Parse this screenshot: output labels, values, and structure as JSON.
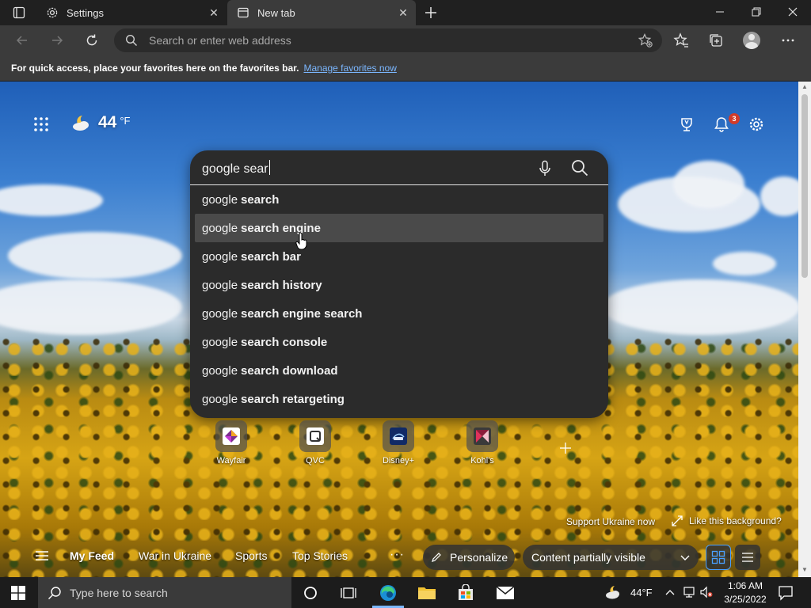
{
  "tabs": [
    {
      "title": "Settings",
      "icon": "gear-icon"
    },
    {
      "title": "New tab",
      "icon": "newtab-icon"
    }
  ],
  "toolbar": {
    "address_placeholder": "Search or enter web address"
  },
  "favorites_bar": {
    "message": "For quick access, place your favorites here on the favorites bar.",
    "link": "Manage favorites now"
  },
  "weather": {
    "temperature": "44",
    "unit": "°F"
  },
  "notifications": {
    "count": "3"
  },
  "search": {
    "query": "google sear",
    "suggestions": [
      {
        "base": "google",
        "completion": "search"
      },
      {
        "base": "google",
        "completion": "search engine"
      },
      {
        "base": "google",
        "completion": "search bar"
      },
      {
        "base": "google",
        "completion": "search history"
      },
      {
        "base": "google",
        "completion": "search engine search"
      },
      {
        "base": "google",
        "completion": "search console"
      },
      {
        "base": "google",
        "completion": "search download"
      },
      {
        "base": "google",
        "completion": "search retargeting"
      }
    ],
    "hovered_index": 1
  },
  "quick_links": [
    {
      "label": "Wayfair"
    },
    {
      "label": "QVC"
    },
    {
      "label": "Disney+"
    },
    {
      "label": "Kohl's"
    }
  ],
  "background": {
    "support_text": "Support Ukraine now",
    "like_text": "Like this background?"
  },
  "feed": {
    "items": [
      "My Feed",
      "War in Ukraine",
      "Sports",
      "Top Stories"
    ],
    "more": "···",
    "personalize": "Personalize",
    "visibility": "Content partially visible"
  },
  "taskbar": {
    "search_placeholder": "Type here to search",
    "weather": "44°F",
    "time": "1:06 AM",
    "date": "3/25/2022"
  },
  "colors": {
    "accent": "#7bb7ff",
    "badge": "#d13b2a"
  }
}
